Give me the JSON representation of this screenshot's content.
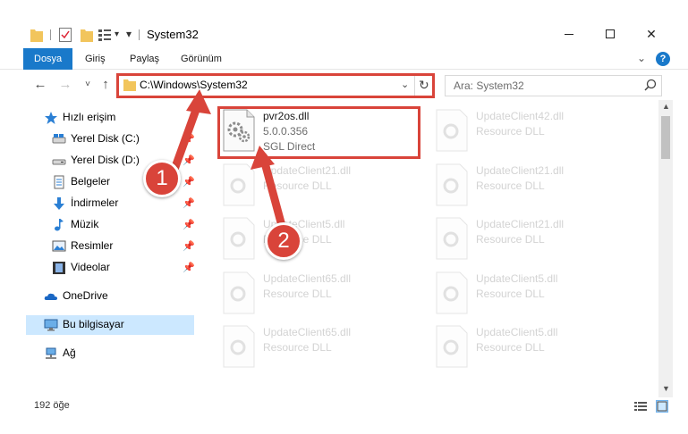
{
  "window": {
    "title": "System32",
    "minimize": "—",
    "maximize": "☐",
    "close": "✕"
  },
  "ribbon": {
    "tabs": [
      "Dosya",
      "Giriş",
      "Paylaş",
      "Görünüm"
    ]
  },
  "navigation": {
    "address": "C:\\Windows\\System32",
    "search_placeholder": "Ara: System32"
  },
  "sidebar": {
    "items": [
      {
        "label": "Hızlı erişim",
        "icon": "star-icon"
      },
      {
        "label": "Yerel Disk (C:)",
        "icon": "drive-icon",
        "pinned": true
      },
      {
        "label": "Yerel Disk (D:)",
        "icon": "drive-icon",
        "pinned": true
      },
      {
        "label": "Belgeler",
        "icon": "documents-icon",
        "pinned": true
      },
      {
        "label": "İndirmeler",
        "icon": "download-icon",
        "pinned": true
      },
      {
        "label": "Müzik",
        "icon": "music-icon",
        "pinned": true
      },
      {
        "label": "Resimler",
        "icon": "pictures-icon",
        "pinned": true
      },
      {
        "label": "Videolar",
        "icon": "video-icon",
        "pinned": true
      },
      {
        "label": "OneDrive",
        "icon": "cloud-icon"
      },
      {
        "label": "Bu bilgisayar",
        "icon": "computer-icon",
        "selected": true
      },
      {
        "label": "Ağ",
        "icon": "network-icon"
      }
    ]
  },
  "files": {
    "highlighted": {
      "name": "pvr2os.dll",
      "version": "5.0.0.356",
      "company": "SGL Direct"
    },
    "faded": [
      {
        "name": "UpdateClient42.dll",
        "desc": "Resource DLL"
      },
      {
        "name": "UpdateClient21.dll",
        "desc": "Resource DLL"
      },
      {
        "name": "UpdateClient21.dll",
        "desc": "Resource DLL"
      },
      {
        "name": "UpdateClient5.dll",
        "desc": "Resource DLL"
      },
      {
        "name": "UpdateClient21.dll",
        "desc": "Resource DLL"
      },
      {
        "name": "UpdateClient65.dll",
        "desc": "Resource DLL"
      },
      {
        "name": "UpdateClient5.dll",
        "desc": "Resource DLL"
      },
      {
        "name": "UpdateClient65.dll",
        "desc": "Resource DLL"
      },
      {
        "name": "UpdateClient5.dll",
        "desc": "Resource DLL"
      }
    ]
  },
  "status": {
    "item_count": "192 öğe"
  },
  "annotations": {
    "step1": "1",
    "step2": "2",
    "color": "#d9443a"
  }
}
